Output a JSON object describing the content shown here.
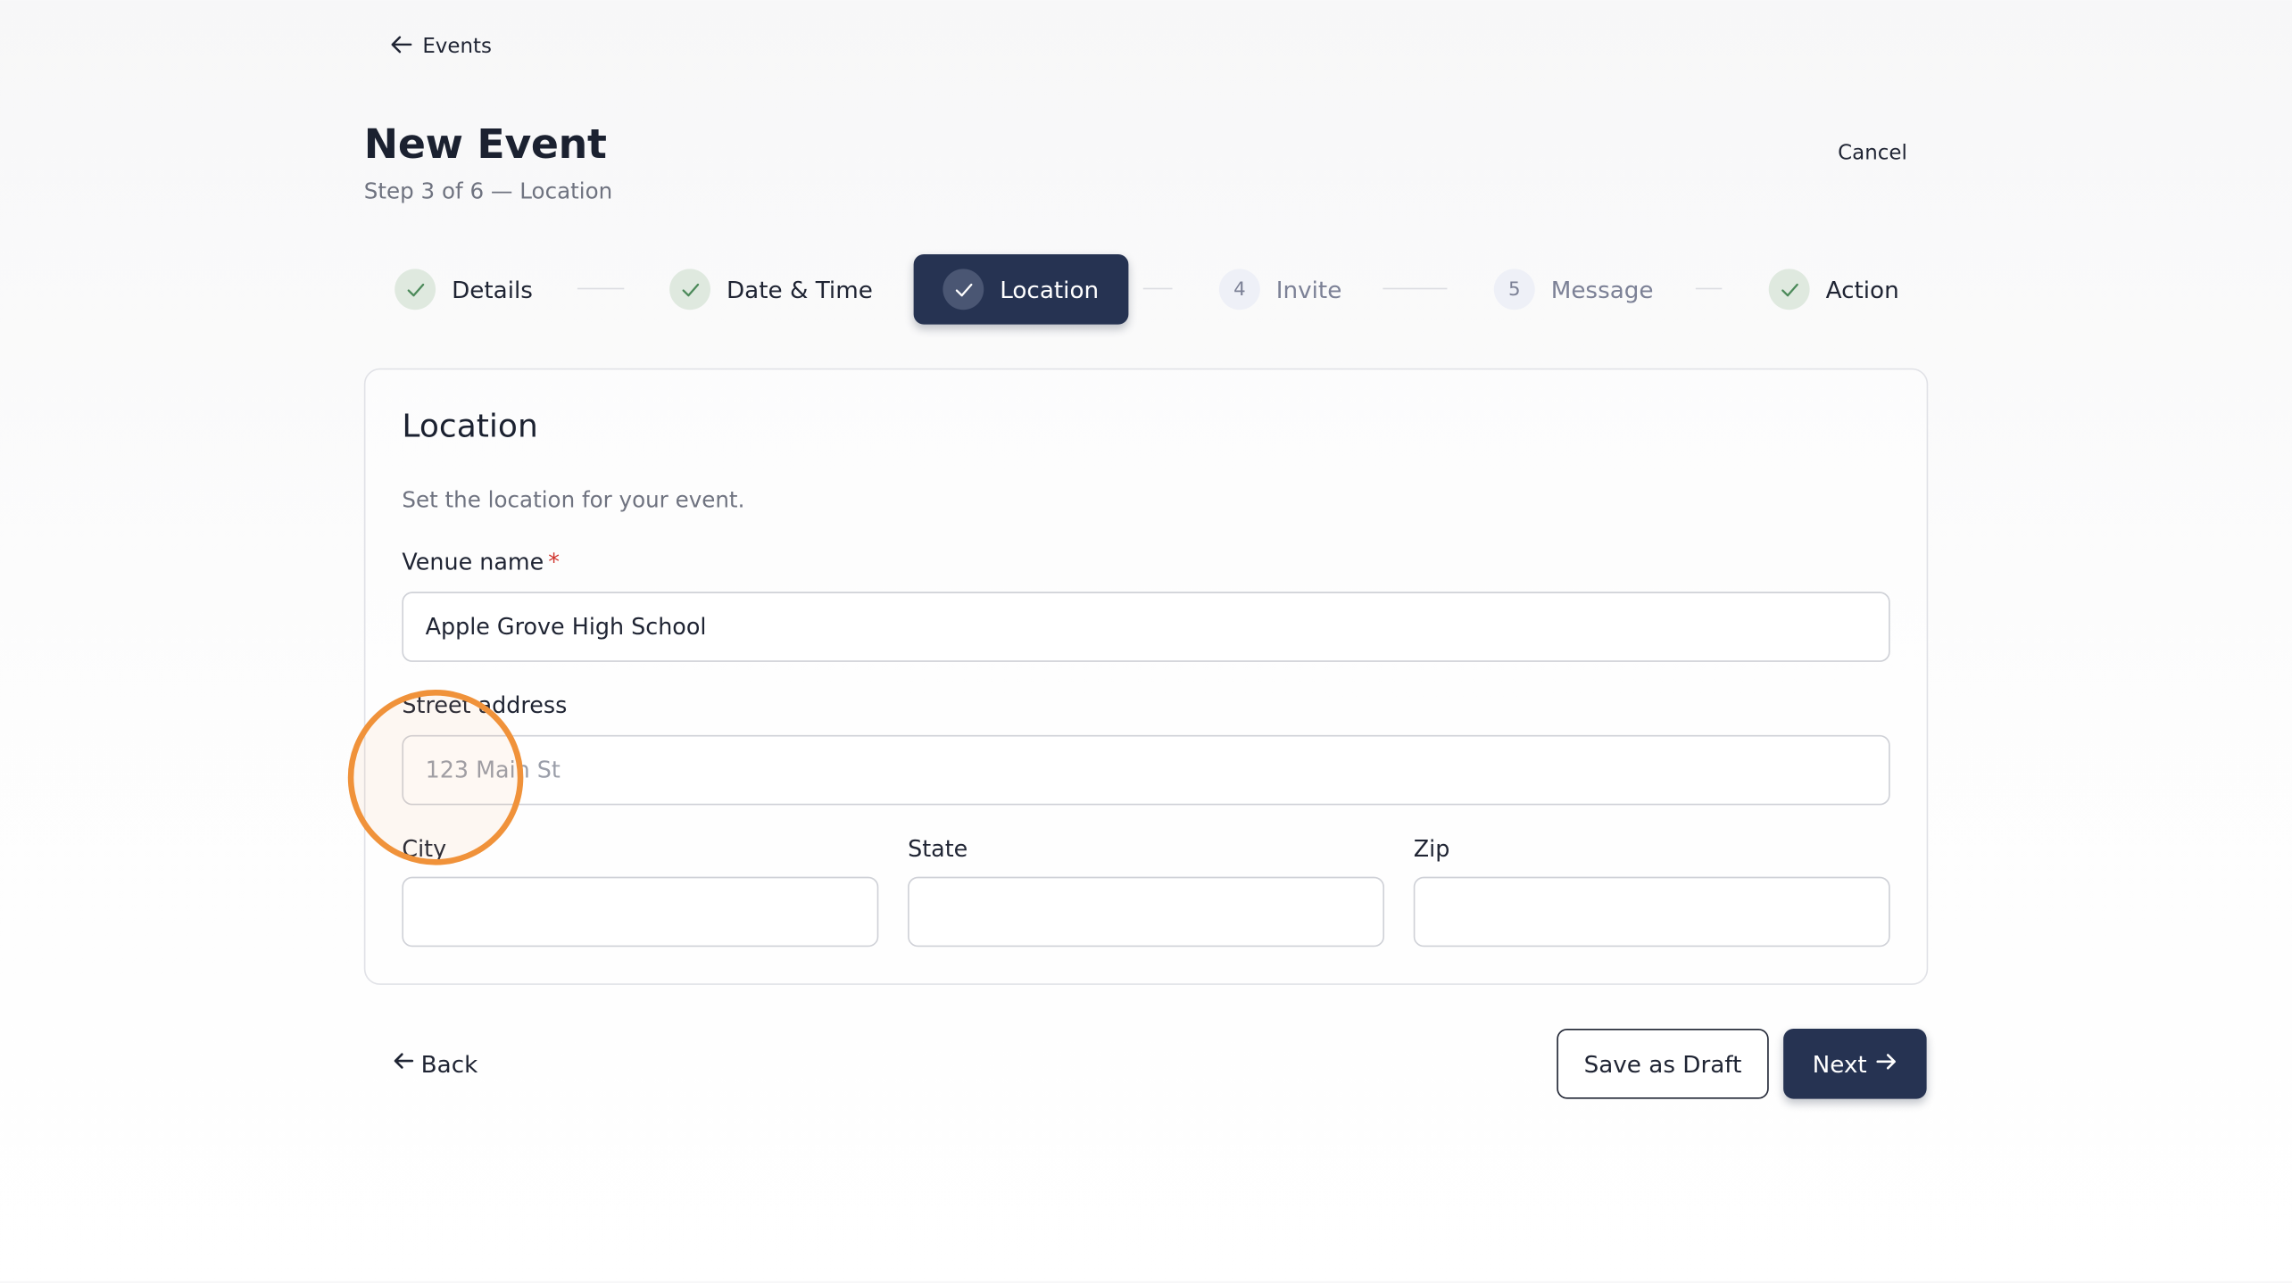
{
  "nav": {
    "back_label": "Events"
  },
  "header": {
    "title": "New Event",
    "subtitle": "Step 3 of 6 — Location",
    "cancel_label": "Cancel"
  },
  "stepper": {
    "steps": [
      {
        "label": "Details",
        "status": "complete",
        "icon": "check-icon"
      },
      {
        "label": "Date & Time",
        "status": "complete",
        "icon": "check-icon"
      },
      {
        "label": "Location",
        "status": "active",
        "icon": "check-icon"
      },
      {
        "label": "Invite",
        "status": "pending",
        "number": "4"
      },
      {
        "label": "Message",
        "status": "pending",
        "number": "5"
      },
      {
        "label": "Action",
        "status": "complete",
        "icon": "check-icon"
      }
    ]
  },
  "card": {
    "title": "Location",
    "description": "Set the location for your event.",
    "fields": {
      "venue": {
        "label": "Venue name",
        "required_marker": "*",
        "value": "Apple Grove High School",
        "placeholder": ""
      },
      "street": {
        "label": "Street address",
        "value": "",
        "placeholder": "123 Main St"
      },
      "city": {
        "label": "City",
        "value": "",
        "placeholder": ""
      },
      "state": {
        "label": "State",
        "value": "",
        "placeholder": ""
      },
      "zip": {
        "label": "Zip",
        "value": "",
        "placeholder": ""
      }
    }
  },
  "footer": {
    "back_label": "Back",
    "save_draft_label": "Save as Draft",
    "next_label": "Next"
  },
  "colors": {
    "primary": "#263352",
    "complete_badge": "#dfe9df",
    "check": "#4c8a5a",
    "required": "#d0352e",
    "click_highlight": "#f0923a"
  }
}
